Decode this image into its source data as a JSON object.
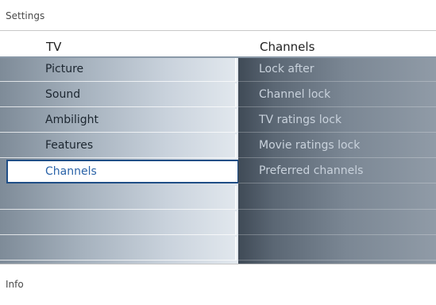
{
  "window": {
    "title": "Settings"
  },
  "header": {
    "left": "TV",
    "right": "Channels"
  },
  "menu": {
    "items": [
      {
        "label": "Picture"
      },
      {
        "label": "Sound"
      },
      {
        "label": "Ambilight"
      },
      {
        "label": "Features"
      },
      {
        "label": "Channels",
        "selected": true
      },
      {
        "label": ""
      },
      {
        "label": ""
      },
      {
        "label": ""
      }
    ]
  },
  "submenu": {
    "items": [
      {
        "label": "Lock after"
      },
      {
        "label": "Channel lock"
      },
      {
        "label": "TV ratings lock"
      },
      {
        "label": "Movie ratings lock"
      },
      {
        "label": "Preferred channels"
      },
      {
        "label": ""
      },
      {
        "label": ""
      },
      {
        "label": ""
      }
    ]
  },
  "info": {
    "label": "Info"
  },
  "colors": {
    "selected_border": "#1f4e86",
    "selected_text": "#2a63a8",
    "right_text": "#c9d2dc"
  }
}
